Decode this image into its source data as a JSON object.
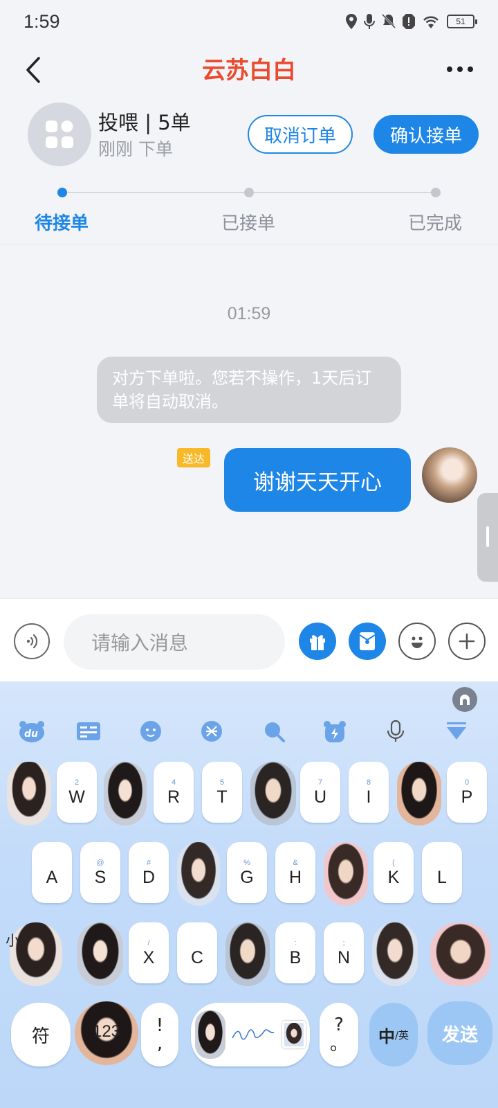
{
  "status": {
    "time": "1:59",
    "battery": "51"
  },
  "header": {
    "title": "云苏白白"
  },
  "order": {
    "title": "投喂 | 5单",
    "subtitle": "刚刚 下单",
    "cancel_label": "取消订单",
    "confirm_label": "确认接单",
    "steps": [
      {
        "label": "待接单",
        "active": true
      },
      {
        "label": "已接单",
        "active": false
      },
      {
        "label": "已完成",
        "active": false
      }
    ]
  },
  "chat": {
    "time": "01:59",
    "system_message": "对方下单啦。您若不操作，1天后订单将自动取消。",
    "sent_badge": "送达",
    "my_message": "谢谢天天开心"
  },
  "input": {
    "placeholder": "请输入消息"
  },
  "keyboard": {
    "row1": [
      {
        "type": "photo"
      },
      {
        "sub": "2",
        "main": "W"
      },
      {
        "type": "photo"
      },
      {
        "sub": "4",
        "main": "R"
      },
      {
        "sub": "5",
        "main": "T"
      },
      {
        "type": "photo"
      },
      {
        "sub": "7",
        "main": "U"
      },
      {
        "sub": "8",
        "main": "I"
      },
      {
        "type": "photo"
      },
      {
        "sub": "0",
        "main": "P"
      }
    ],
    "row2": [
      {
        "sub": "",
        "main": "A"
      },
      {
        "sub": "@",
        "main": "S"
      },
      {
        "sub": "#",
        "main": "D"
      },
      {
        "type": "photo"
      },
      {
        "sub": "%",
        "main": "G"
      },
      {
        "sub": "&",
        "main": "H"
      },
      {
        "type": "photo"
      },
      {
        "sub": "(",
        "main": "K"
      },
      {
        "sub": "",
        "main": "L"
      }
    ],
    "row3": [
      {
        "type": "photo"
      },
      {
        "sub": "/",
        "main": "X"
      },
      {
        "sub": "",
        "main": "C"
      },
      {
        "type": "photo"
      },
      {
        "sub": ":",
        "main": "B"
      },
      {
        "sub": ";",
        "main": "N"
      },
      {
        "type": "photo"
      }
    ],
    "bottom": {
      "symbol_label": "符",
      "number_label": "123",
      "punct_top": "!",
      "punct_bottom": ",",
      "qmark_top": "?",
      "qmark_bottom": "。",
      "lang_label": "中",
      "lang_small": "/英",
      "send_label": "发送",
      "left_edge_label": "小"
    }
  }
}
